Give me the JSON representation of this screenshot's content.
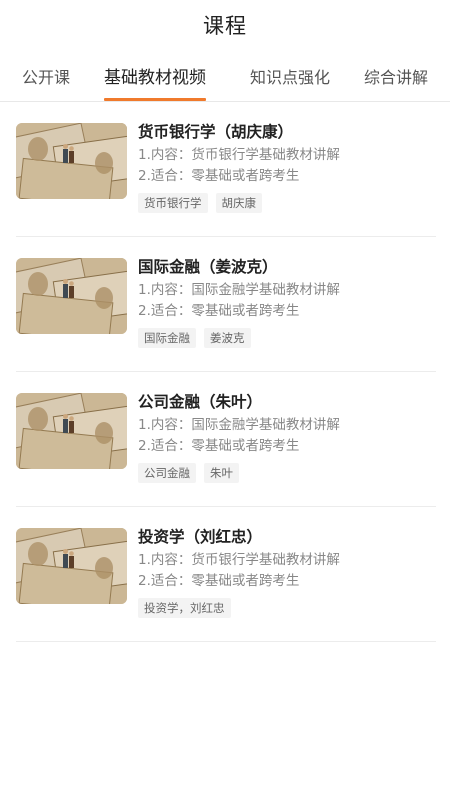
{
  "header": {
    "title": "课程"
  },
  "tabs": [
    {
      "label": "公开课",
      "active": false
    },
    {
      "label": "基础教材视频",
      "active": true
    },
    {
      "label": "知识点强化",
      "active": false
    },
    {
      "label": "综合讲解",
      "active": false
    }
  ],
  "courses": [
    {
      "title": "货币银行学（胡庆康）",
      "content": "1.内容：货币银行学基础教材讲解",
      "suitable": "2.适合：零基础或者跨考生",
      "tags": [
        "货币银行学",
        "胡庆康"
      ]
    },
    {
      "title": "国际金融（姜波克）",
      "content": "1.内容：国际金融学基础教材讲解",
      "suitable": "2.适合：零基础或者跨考生",
      "tags": [
        "国际金融",
        "姜波克"
      ]
    },
    {
      "title": "公司金融（朱叶）",
      "content": "1.内容：国际金融学基础教材讲解",
      "suitable": "2.适合：零基础或者跨考生",
      "tags": [
        "公司金融",
        "朱叶"
      ]
    },
    {
      "title": "投资学（刘红忠）",
      "content": "1.内容：货币银行学基础教材讲解",
      "suitable": "2.适合：零基础或者跨考生",
      "tags": [
        "投资学，刘红忠"
      ]
    }
  ],
  "icons": {
    "thumbnail": "money-banknotes-with-figurines-image"
  },
  "colors": {
    "accent": "#f07a2c",
    "text": "#222222",
    "muted": "#888888",
    "tag_bg": "#f3f3f3"
  }
}
